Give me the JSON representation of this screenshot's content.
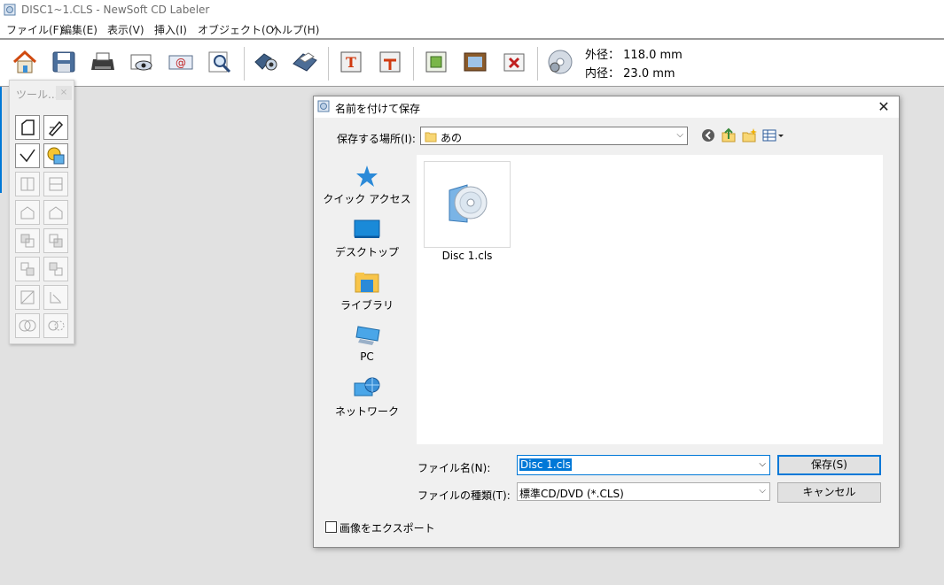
{
  "window": {
    "title": "DISC1~1.CLS - NewSoft CD Labeler"
  },
  "menu": [
    "ファイル(F)",
    "編集(E)",
    "表示(V)",
    "挿入(I)",
    "オブジェクト(O)",
    "ヘルプ(H)"
  ],
  "toolbar": {
    "icons": [
      "home-icon",
      "save-icon",
      "print-icon",
      "preview-icon",
      "email-icon",
      "zoom-icon",
      "camera-icon",
      "scanner-icon",
      "text-icon",
      "curve-text-icon",
      "image-icon",
      "frame-icon",
      "import-icon",
      "disc-settings-icon"
    ],
    "outer_label": "外径：",
    "outer_value": "118.0 mm",
    "inner_label": "内径：",
    "inner_value": "23.0 mm"
  },
  "palette": {
    "title": "ツール...",
    "close": "×"
  },
  "dialog": {
    "title": "名前を付けて保存",
    "close": "✕",
    "location_label": "保存する場所(I):",
    "location_value": "あの",
    "places": [
      {
        "label": "クイック アクセス",
        "icon": "quick-access-icon"
      },
      {
        "label": "デスクトップ",
        "icon": "desktop-icon"
      },
      {
        "label": "ライブラリ",
        "icon": "library-icon"
      },
      {
        "label": "PC",
        "icon": "pc-icon"
      },
      {
        "label": "ネットワーク",
        "icon": "network-icon"
      }
    ],
    "files": [
      {
        "name": "Disc 1.cls"
      }
    ],
    "filename_label": "ファイル名(N):",
    "filename_value": "Disc 1.cls",
    "filetype_label": "ファイルの種類(T):",
    "filetype_value": "標準CD/DVD (*.CLS)",
    "save_button": "保存(S)",
    "cancel_button": "キャンセル",
    "export_checkbox_label": "画像をエクスポート",
    "export_checked": false
  },
  "colors": {
    "accent": "#0078d7",
    "folder": "#f8d775"
  }
}
